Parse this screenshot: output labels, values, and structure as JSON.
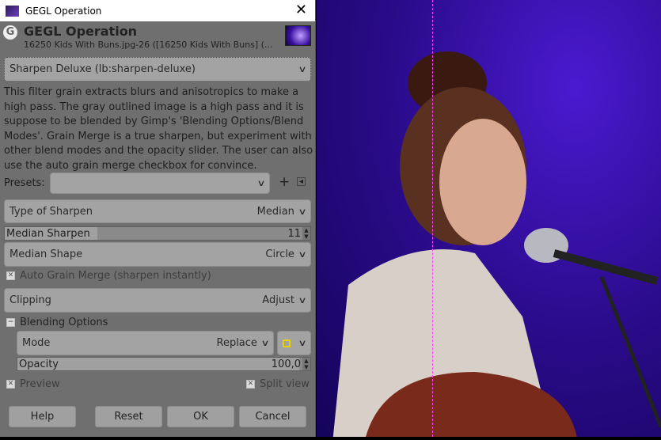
{
  "window": {
    "title": "GEGL Operation",
    "close": "✕"
  },
  "header": {
    "title": "GEGL Operation",
    "subtitle": "16250 Kids With Buns.jpg-26 ([16250 Kids With Buns] (..."
  },
  "operation": {
    "selected": "Sharpen Deluxe (lb:sharpen-deluxe)"
  },
  "description": "This filter grain extracts blurs and anisotropics to make a high pass. The gray outlined image is a high pass and it is suppose to be blended by Gimp's 'Blending Options/Blend Modes'. Grain Merge is a true sharpen, but experiment with other blend modes and the opacity slider. The user can also use the auto grain merge checkbox for convince.",
  "presets": {
    "label": "Presets:",
    "value": "",
    "add": "+",
    "menu": "◂"
  },
  "params": {
    "type_of_sharpen": {
      "label": "Type of Sharpen",
      "value": "Median"
    },
    "median_sharpen": {
      "label": "Median Sharpen",
      "value": "11"
    },
    "median_shape": {
      "label": "Median Shape",
      "value": "Circle"
    },
    "auto_grain": {
      "label": "Auto Grain Merge (sharpen instantly)",
      "checked": true
    },
    "clipping": {
      "label": "Clipping",
      "value": "Adjust"
    }
  },
  "blending": {
    "label": "Blending Options",
    "mode_label": "Mode",
    "mode_value": "Replace",
    "opacity_label": "Opacity",
    "opacity_value": "100,0"
  },
  "preview": {
    "label": "Preview",
    "checked": true
  },
  "split_view": {
    "label": "Split view",
    "checked": true
  },
  "buttons": {
    "help": "Help",
    "reset": "Reset",
    "ok": "OK",
    "cancel": "Cancel"
  }
}
